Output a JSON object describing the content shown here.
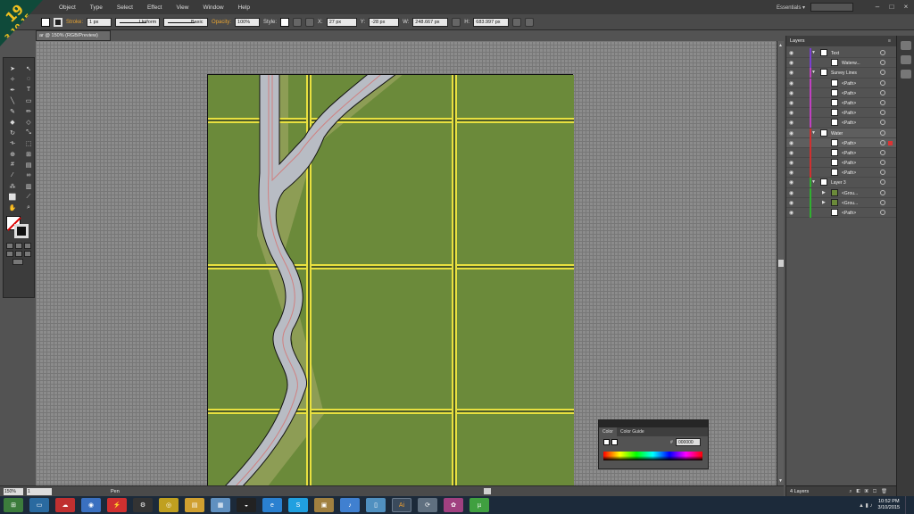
{
  "badge": {
    "number": "19",
    "date": "3.10.15"
  },
  "menu": {
    "items": [
      "Object",
      "Type",
      "Select",
      "Effect",
      "View",
      "Window",
      "Help"
    ],
    "workspace": "Essentials ▾"
  },
  "controlbar": {
    "stroke_label": "Stroke:",
    "stroke_weight": "1 px",
    "profile": "Uniform",
    "brush": "Basic",
    "opacity_label": "Opacity:",
    "opacity_value": "100%",
    "style_label": "Style:",
    "x_label": "X:",
    "x_value": "27 px",
    "y_label": "Y:",
    "y_value": "-28 px",
    "w_label": "W:",
    "w_value": "248.667 px",
    "h_label": "H:",
    "h_value": "683.997 px"
  },
  "document": {
    "tab_title": "ar @ 150% (RGB/Preview)"
  },
  "status": {
    "zoom": "150%",
    "page": "1",
    "tool": "Pen"
  },
  "layers_panel": {
    "title": "Layers",
    "footer": "4 Layers",
    "rows": [
      {
        "name": "Text",
        "color": "#7a3fd0",
        "indent": 0,
        "expandable": true,
        "expanded": true,
        "selected": false
      },
      {
        "name": "Waterw...",
        "color": "#7a3fd0",
        "indent": 1,
        "expandable": false,
        "selected": false
      },
      {
        "name": "Survey Lines",
        "color": "#c040c0",
        "indent": 0,
        "expandable": true,
        "expanded": true,
        "selected": false
      },
      {
        "name": "<Path>",
        "color": "#c040c0",
        "indent": 1,
        "expandable": false,
        "selected": false
      },
      {
        "name": "<Path>",
        "color": "#c040c0",
        "indent": 1,
        "expandable": false,
        "selected": false
      },
      {
        "name": "<Path>",
        "color": "#c040c0",
        "indent": 1,
        "expandable": false,
        "selected": false
      },
      {
        "name": "<Path>",
        "color": "#c040c0",
        "indent": 1,
        "expandable": false,
        "selected": false
      },
      {
        "name": "<Path>",
        "color": "#c040c0",
        "indent": 1,
        "expandable": false,
        "selected": false
      },
      {
        "name": "Water",
        "color": "#d03030",
        "indent": 0,
        "expandable": true,
        "expanded": true,
        "selected": true
      },
      {
        "name": "<Path>",
        "color": "#d03030",
        "indent": 1,
        "expandable": false,
        "selected": true
      },
      {
        "name": "<Path>",
        "color": "#d03030",
        "indent": 1,
        "expandable": false,
        "selected": false
      },
      {
        "name": "<Path>",
        "color": "#d03030",
        "indent": 1,
        "expandable": false,
        "selected": false
      },
      {
        "name": "<Path>",
        "color": "#d03030",
        "indent": 1,
        "expandable": false,
        "selected": false
      },
      {
        "name": "Layer 3",
        "color": "#30b030",
        "indent": 0,
        "expandable": true,
        "expanded": true,
        "selected": false
      },
      {
        "name": "<Grou...",
        "color": "#30b030",
        "indent": 1,
        "expandable": true,
        "selected": false,
        "green": true
      },
      {
        "name": "<Grou...",
        "color": "#30b030",
        "indent": 1,
        "expandable": true,
        "selected": false,
        "green": true
      },
      {
        "name": "<Path>",
        "color": "#30b030",
        "indent": 1,
        "expandable": false,
        "selected": false
      }
    ]
  },
  "color_panel": {
    "tabs": [
      "Color",
      "Color Guide"
    ],
    "hash": "#",
    "hex_value": "000000"
  },
  "taskbar": {
    "time": "10:52 PM",
    "date": "3/10/2015",
    "apps": [
      "start",
      "monitor",
      "cloud",
      "chrome-like",
      "lightning",
      "steam",
      "chrome",
      "explorer",
      "notepad",
      "qq",
      "edge",
      "skype",
      "photos",
      "itunes",
      "tablet",
      "illustrator",
      "rotate",
      "paint",
      "utorrent"
    ]
  },
  "colors": {
    "canvas_bg": "#8c8c8c",
    "artboard_fill": "#6b8a3a",
    "grid_line": "#e8e040",
    "river_fill": "#b8bcc4",
    "river_edge": "#d08080"
  }
}
